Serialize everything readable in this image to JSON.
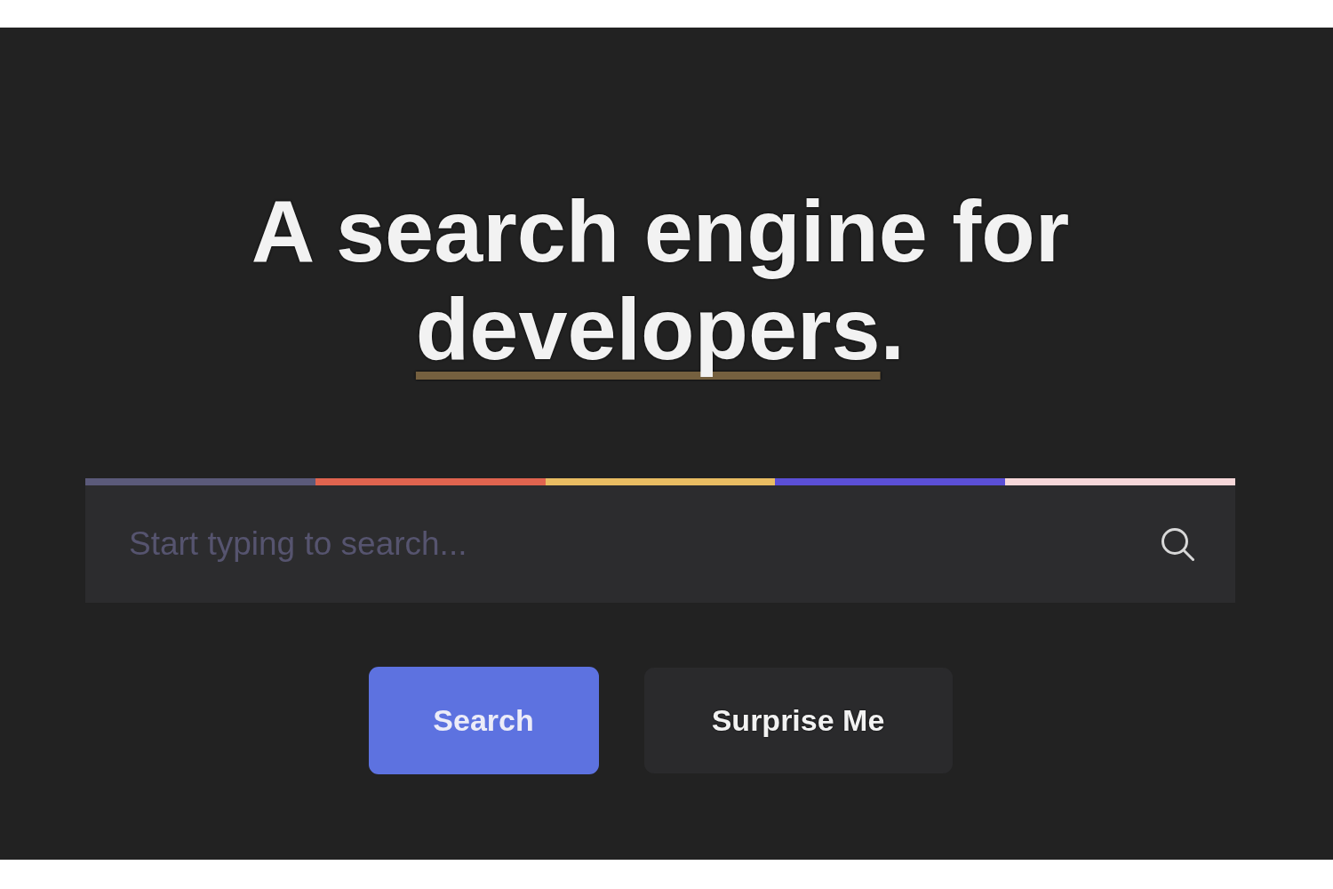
{
  "headline": {
    "lead": "A search engine for",
    "highlight": "developers",
    "trail": "."
  },
  "accent_stripe": [
    {
      "color": "#5b5a7a"
    },
    {
      "color": "#e0644f"
    },
    {
      "color": "#e9bd63"
    },
    {
      "color": "#5b4fd6"
    },
    {
      "color": "#f6d7d9"
    }
  ],
  "search_field": {
    "placeholder": "Start typing to search..."
  },
  "buttons": [
    {
      "label": "Search",
      "kind": "primary"
    },
    {
      "label": "Surprise Me",
      "kind": "secondary"
    }
  ]
}
